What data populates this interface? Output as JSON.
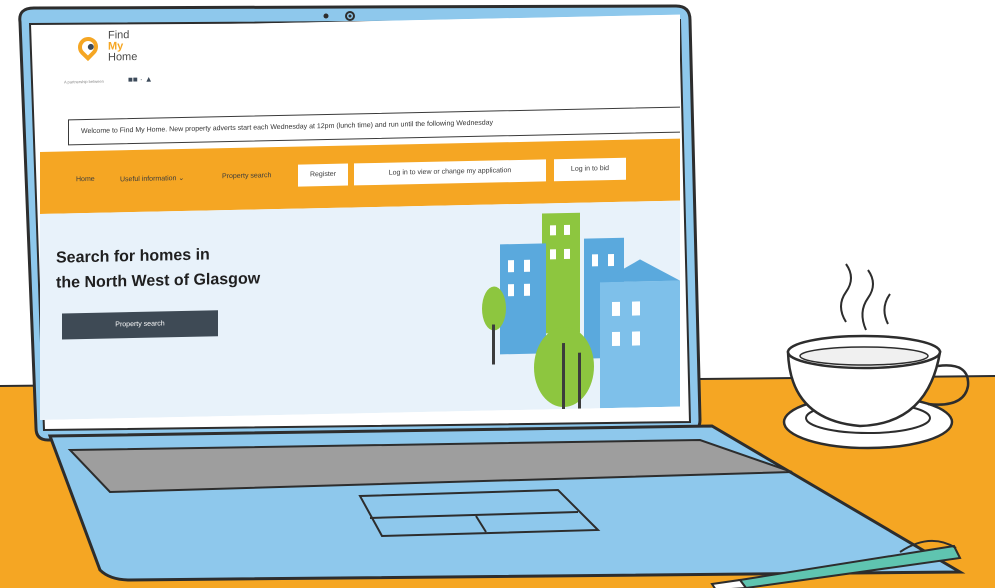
{
  "site": {
    "logo": {
      "line1": "Find",
      "line2": "My",
      "line3": "Home"
    },
    "partnership": "A partnership between"
  },
  "welcome_banner": "Welcome to Find My Home. New property adverts start each Wednesday at 12pm (lunch time) and run until the following Wednesday",
  "nav": {
    "home": "Home",
    "useful_info": "Useful information",
    "useful_info_caret": "⌄",
    "property_search": "Property search",
    "register": "Register",
    "login_application": "Log in to view or change my application",
    "login_bid": "Log in to bid"
  },
  "hero": {
    "title_line1": "Search for homes in",
    "title_line2": "the North West of Glasgow",
    "button": "Property search"
  },
  "colors": {
    "accent_orange": "#f5a623",
    "laptop_blue": "#8ec8ec",
    "dark_button": "#3e4a55",
    "hero_bg": "#e8f2fa",
    "tree_green": "#8dc63f",
    "pen_teal": "#5fc4b0"
  },
  "icons": [
    "location-pin-icon",
    "chevron-down-icon",
    "coffee-cup-icon",
    "pen-icon",
    "webcam-icon"
  ]
}
